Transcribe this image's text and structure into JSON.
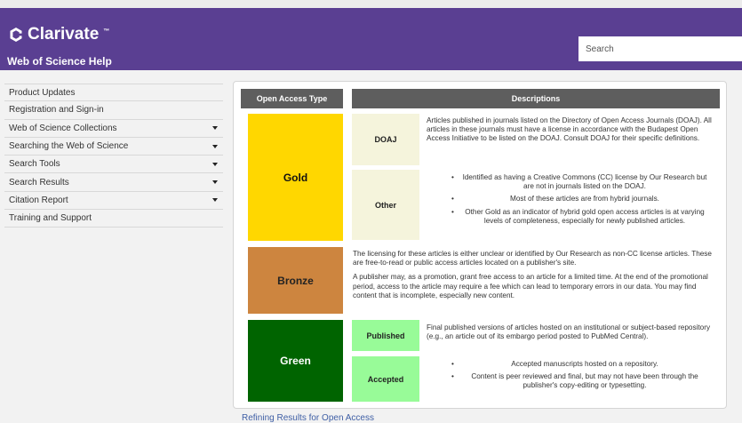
{
  "header": {
    "brand": "Clarivate",
    "brand_mark": "™",
    "subtitle": "Web of Science Help",
    "search_placeholder": "Search"
  },
  "sidebar": {
    "items": [
      {
        "label": "Product Updates",
        "expandable": false
      },
      {
        "label": "Registration and Sign-in",
        "expandable": false
      },
      {
        "label": "Web of Science Collections",
        "expandable": true
      },
      {
        "label": "Searching the Web of Science",
        "expandable": true
      },
      {
        "label": "Search Tools",
        "expandable": true
      },
      {
        "label": "Search Results",
        "expandable": true
      },
      {
        "label": "Citation Report",
        "expandable": true
      },
      {
        "label": "Training and Support",
        "expandable": false
      }
    ]
  },
  "table": {
    "col_type": "Open Access Type",
    "col_desc": "Descriptions",
    "gold": {
      "label": "Gold",
      "color": "#ffd700",
      "doaj_label": "DOAJ",
      "doaj_text": "Articles published in journals listed on the Directory of Open Access Journals (DOAJ). All articles in these journals must have a license in accordance with the Budapest Open Access Initiative to be listed on the DOAJ. Consult DOAJ for their specific definitions.",
      "other_label": "Other",
      "other_bullets": [
        "Identified as having a Creative Commons (CC) license by Our Research but are not in journals listed on the DOAJ.",
        "Most of these articles are from hybrid journals.",
        "Other Gold as an indicator of hybrid gold open access articles is at varying levels of completeness, especially for newly published articles."
      ]
    },
    "bronze": {
      "label": "Bronze",
      "color": "#cd853f",
      "para1": "The licensing for these articles is either unclear or identified by Our Research as non-CC license articles. These are free-to-read or public access articles located on a publisher's site.",
      "para2": "A publisher may, as a promotion, grant free access to an article for a limited time. At the end of the promotional period, access to the article may require a fee which can lead to temporary errors in our data. You may find content that is incomplete, especially new content."
    },
    "green": {
      "label": "Green",
      "color": "#006400",
      "published_label": "Published",
      "published_text": "Final published versions of articles hosted on an institutional or subject-based repository (e.g., an article out of its embargo period posted to PubMed Central).",
      "accepted_label": "Accepted",
      "accepted_bullets": [
        "Accepted manuscripts hosted on a repository.",
        "Content is peer reviewed and final, but may not have been through the publisher's copy-editing or typesetting."
      ]
    }
  },
  "footer_link": "Refining Results for Open Access"
}
